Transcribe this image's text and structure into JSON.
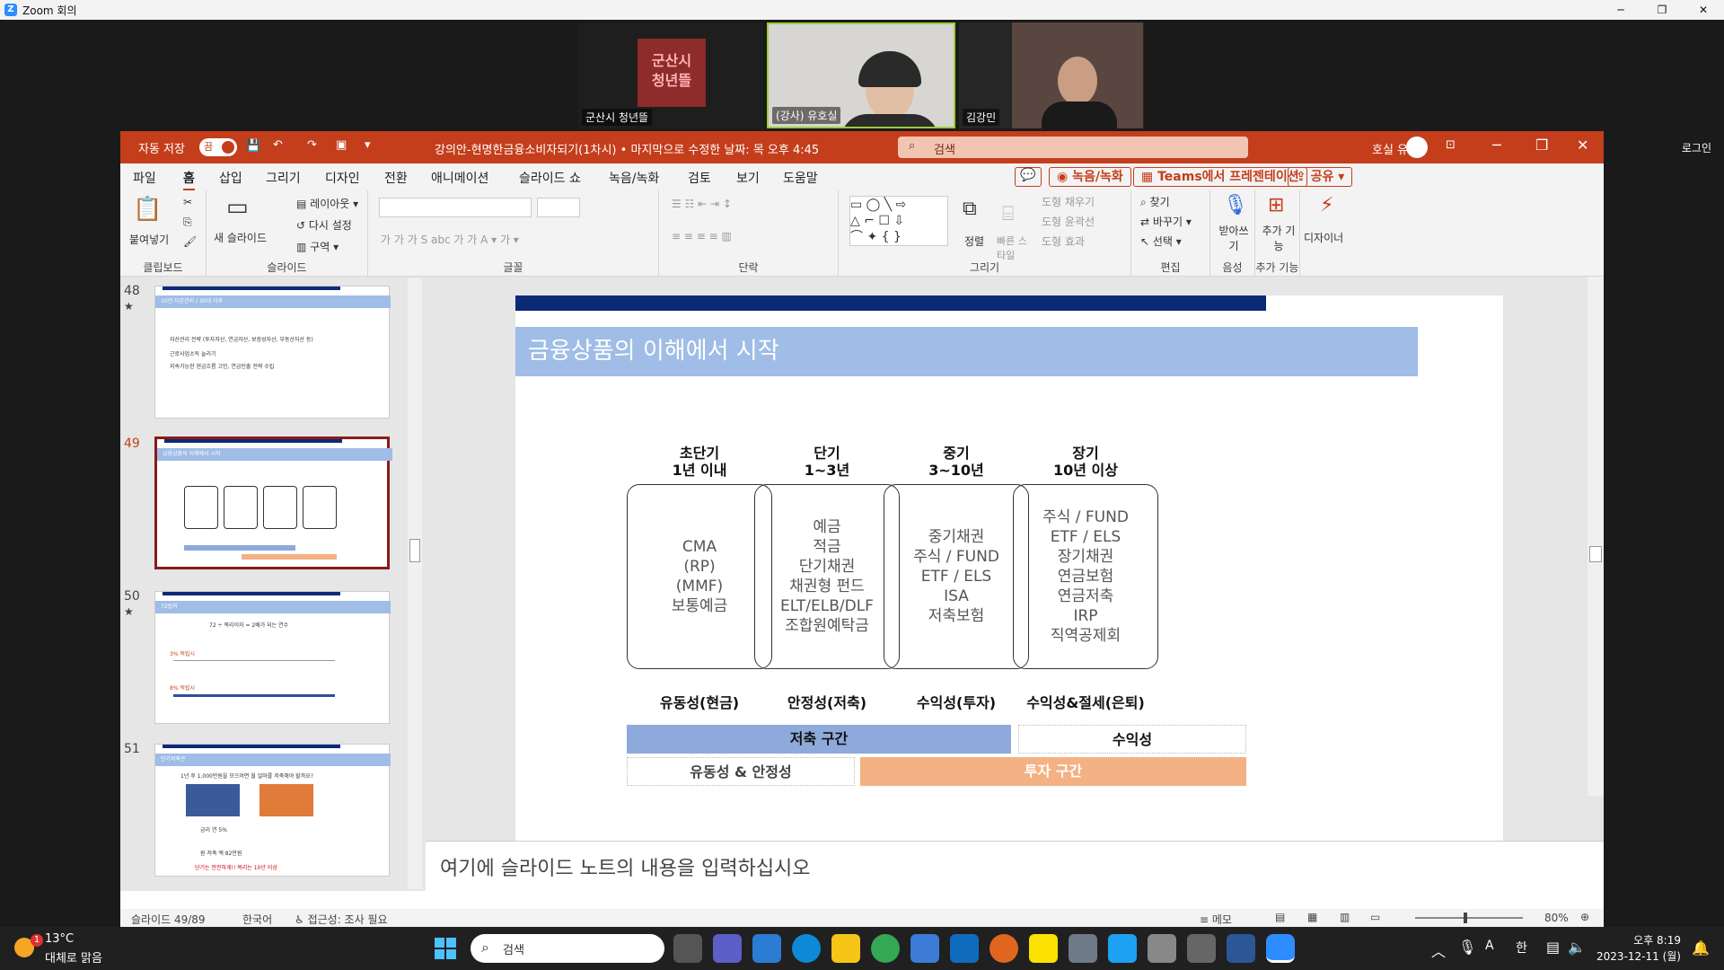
{
  "zoom": {
    "window_title": "Zoom 회의",
    "login_label": "로그인",
    "participants": [
      {
        "name": "군산시 청년뜰",
        "logo_text": "군산시\n청년뜰"
      },
      {
        "name": "(강사) 유호실"
      },
      {
        "name": "김강민"
      }
    ]
  },
  "ppt": {
    "autosave_label": "자동 저장",
    "autosave_state": "끔",
    "doc_title": "강의안-현명한금융소비자되기(1차시) • 마지막으로 수정한 날짜: 목 오후 4:45",
    "search_placeholder": "검색",
    "user_name": "호실 유",
    "tabs": [
      "파일",
      "홈",
      "삽입",
      "그리기",
      "디자인",
      "전환",
      "애니메이션",
      "슬라이드 쇼",
      "녹음/녹화",
      "검토",
      "보기",
      "도움말"
    ],
    "active_tab": "홈",
    "right_buttons": {
      "record": "녹음/녹화",
      "teams": "Teams에서 프레젠테이션",
      "share": "공유"
    },
    "ribbon": {
      "clipboard": {
        "paste": "붙여넣기",
        "label": "클립보드"
      },
      "slides": {
        "new_slide": "새 슬라이드",
        "layout": "레이아웃",
        "reset": "다시 설정",
        "section": "구역",
        "label": "슬라이드"
      },
      "font": {
        "label": "글꼴"
      },
      "paragraph": {
        "label": "단락"
      },
      "drawing": {
        "arrange": "정렬",
        "quick_styles": "빠른 스타일",
        "fill": "도형 채우기",
        "outline": "도형 윤곽선",
        "effects": "도형 효과",
        "label": "그리기"
      },
      "editing": {
        "find": "찾기",
        "replace": "바꾸기",
        "select": "선택",
        "label": "편집"
      },
      "voice": {
        "dictate": "받아쓰기",
        "label": "음성"
      },
      "addins": {
        "addins": "추가 기능",
        "label": "추가 기능"
      },
      "designer": {
        "label": "디자이너"
      }
    },
    "thumbnails": [
      {
        "num": "48",
        "star": "★",
        "title": "10년 자본관리 / 30대 이후",
        "lines": [
          "자산관리 전략 (투자자산, 연금자산, 보장성자산, 부동산자산 등)",
          "근로사업소득 늘리기",
          "지속가능한 현금흐름 고민, 연금인출 전략 수립"
        ]
      },
      {
        "num": "49",
        "star": "",
        "title": "금융상품의 이해에서 시작",
        "lines": []
      },
      {
        "num": "50",
        "star": "★",
        "title": "72법칙",
        "lines": [
          "72 ÷ 복리이자 = 2배가 되는 연수",
          "3% 적립시",
          "8% 적립시"
        ]
      },
      {
        "num": "51",
        "star": "",
        "title": "단기저축은",
        "lines": [
          "1년 후 1,000만원을 모으려면 월 얼마를 저축해야 할까요?",
          "금리 연 5%",
          "원 저축 액 82만원",
          "단기는 안전하게!! 복리는 10년 이상"
        ]
      }
    ],
    "slide": {
      "header": "금융상품의 이해에서 시작",
      "columns": [
        {
          "head1": "초단기",
          "head2": "1년 이내",
          "items": [
            "CMA",
            "(RP)",
            "(MMF)",
            "보통예금"
          ],
          "label": "유동성(현금)"
        },
        {
          "head1": "단기",
          "head2": "1~3년",
          "items": [
            "예금",
            "적금",
            "단기채권",
            "채권형 펀드",
            "ELT/ELB/DLF",
            "조합원예탁금"
          ],
          "label": "안정성(저축)"
        },
        {
          "head1": "중기",
          "head2": "3~10년",
          "items": [
            "중기채권",
            "주식 / FUND",
            "ETF / ELS",
            "ISA",
            "저축보험"
          ],
          "label": "수익성(투자)"
        },
        {
          "head1": "장기",
          "head2": "10년 이상",
          "items": [
            "주식 / FUND",
            "ETF / ELS",
            "장기채권",
            "연금보험",
            "연금저축",
            "IRP",
            "직역공제회"
          ],
          "label": "수익성&절세(은퇴)"
        }
      ],
      "segments": {
        "saving": "저축 구간",
        "profit": "수익성",
        "liquidity": "유동성 & 안정성",
        "invest": "투자 구간"
      }
    },
    "notes_placeholder": "여기에 슬라이드 노트의 내용을 입력하십시오",
    "status": {
      "slide_pos": "슬라이드 49/89",
      "language": "한국어",
      "accessibility": "접근성: 조사 필요",
      "notes_btn": "메모",
      "zoom": "80%"
    }
  },
  "taskbar": {
    "weather_temp": "13°C",
    "weather_desc": "대체로 맑음",
    "weather_badge": "1",
    "search": "검색",
    "time": "오후 8:19",
    "date": "2023-12-11 (월)",
    "ime": "한",
    "ime_a": "A"
  },
  "colors": {
    "ppt_accent": "#c43e1c",
    "slide_navy": "#0a2a78",
    "slide_blue": "#9fbde6",
    "seg_blue": "#8eaadb",
    "seg_orange": "#f4b183"
  }
}
